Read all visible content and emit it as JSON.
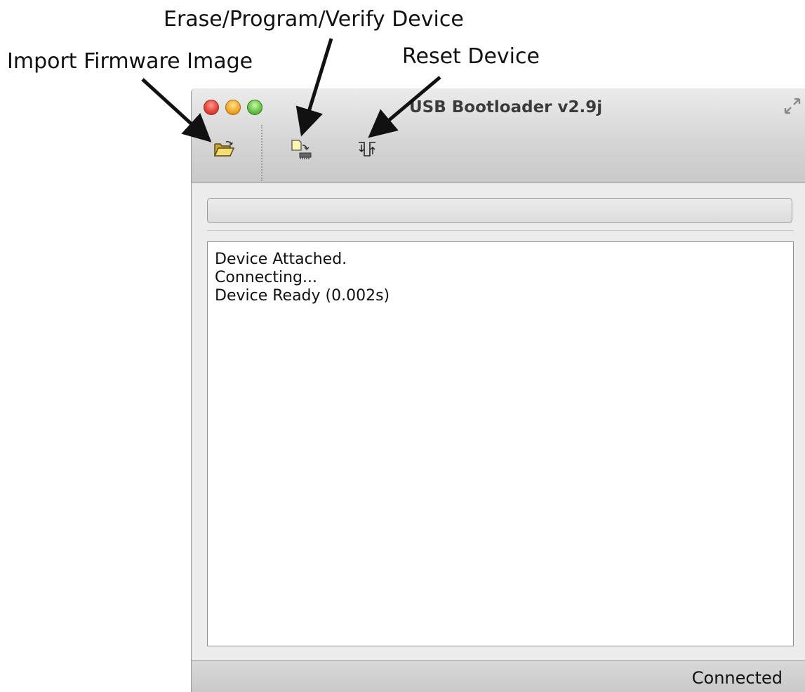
{
  "annotations": {
    "import": "Import Firmware Image",
    "program": "Erase/Program/Verify Device",
    "reset": "Reset Device"
  },
  "window": {
    "title": "USB Bootloader v2.9j"
  },
  "toolbar": {
    "buttons": [
      {
        "id": "import",
        "icon": "folder-open-icon"
      },
      {
        "id": "program",
        "icon": "program-device-icon"
      },
      {
        "id": "reset",
        "icon": "reset-device-icon"
      }
    ]
  },
  "progress": {
    "value": 0
  },
  "log": {
    "lines": [
      "Device Attached.",
      "Connecting...",
      "Device Ready (0.002s)"
    ]
  },
  "status": {
    "text": "Connected"
  }
}
